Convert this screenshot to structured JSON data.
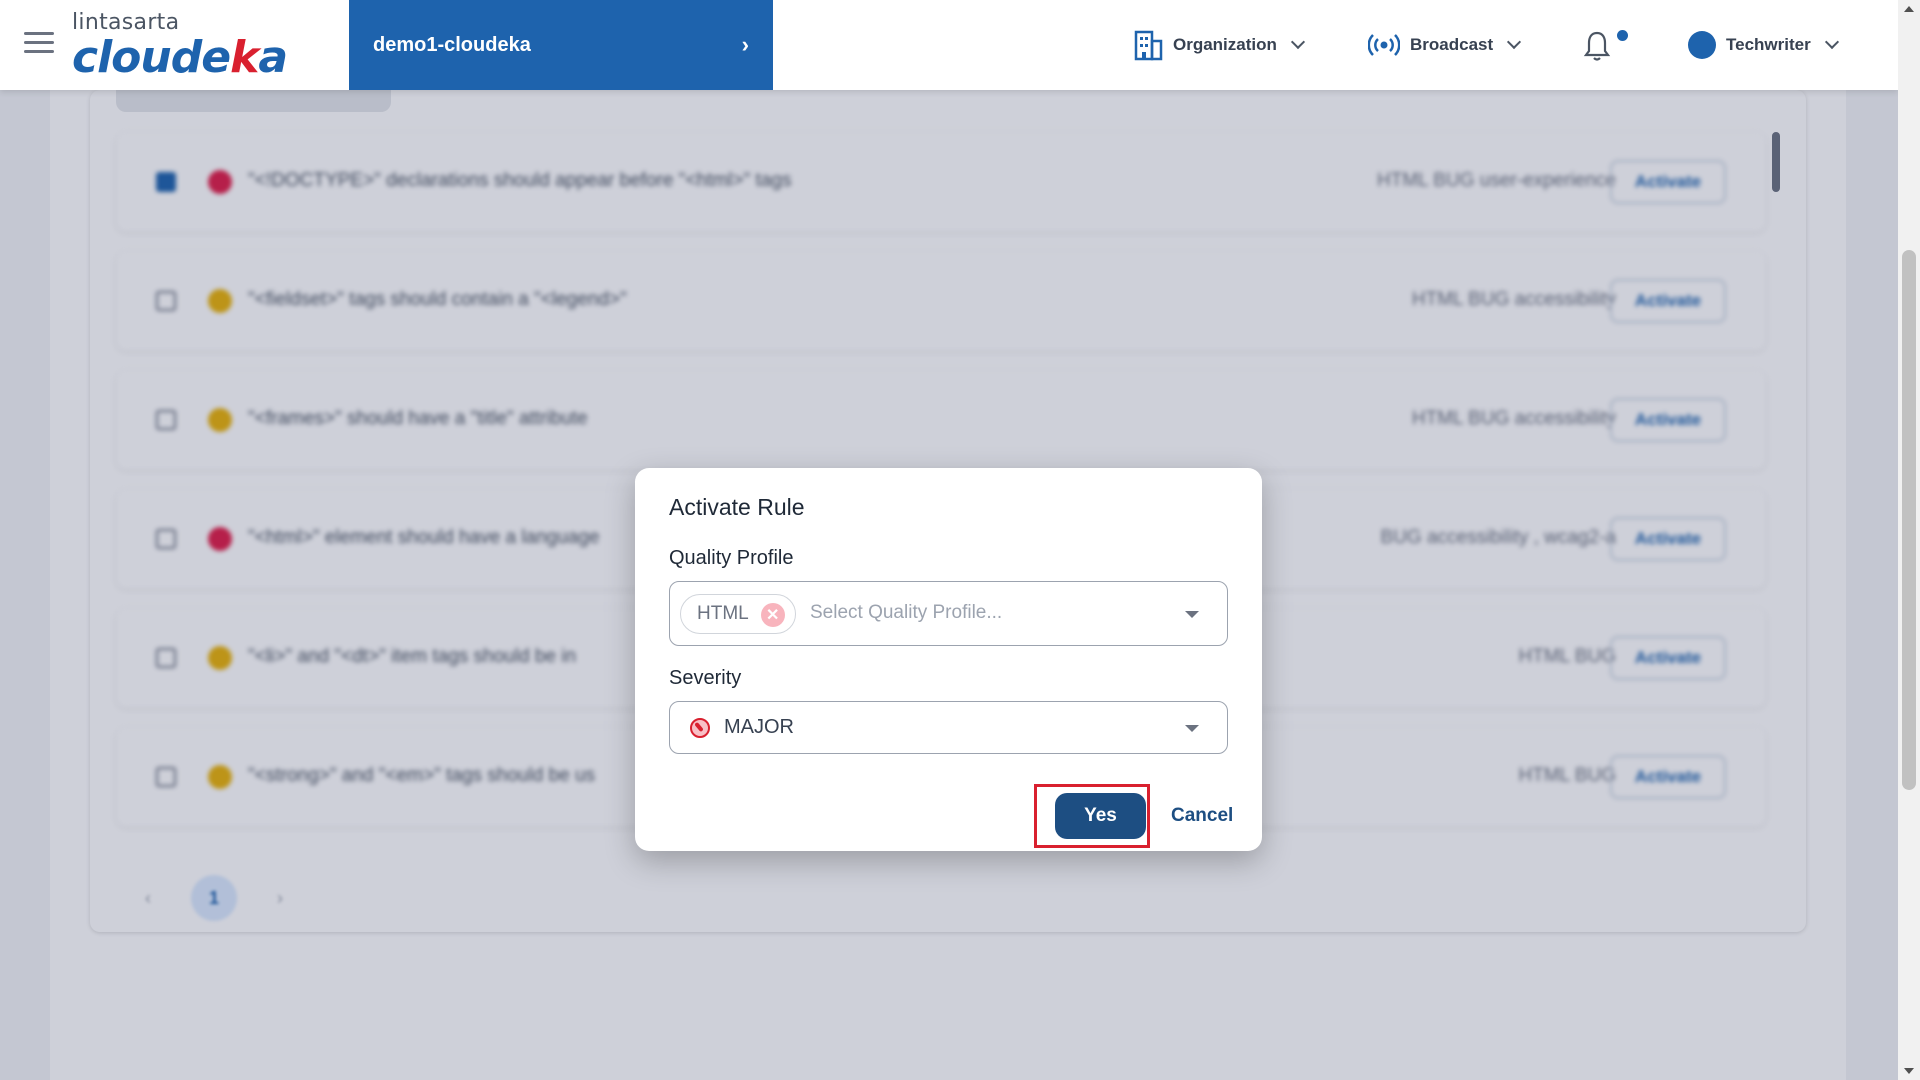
{
  "header": {
    "logo_top": "lintasarta",
    "logo_main_prefix": "cloude",
    "logo_main_accent": "k",
    "logo_main_suffix": "a",
    "project_name": "demo1-cloudeka",
    "nav": {
      "organization": "Organization",
      "broadcast": "Broadcast",
      "user": "Techwriter"
    }
  },
  "rules": [
    {
      "title": "\"<!DOCTYPE>\" declarations should appear before \"<html>\" tags",
      "meta": "HTML   BUG   user-experience",
      "checked": true,
      "severity": "major"
    },
    {
      "title": "\"<fieldset>\" tags should contain a \"<legend>\"",
      "meta": "HTML   BUG   accessibility",
      "checked": false,
      "severity": "minor"
    },
    {
      "title": "\"<frames>\" should have a \"title\" attribute",
      "meta": "HTML   BUG   accessibility",
      "checked": false,
      "severity": "minor"
    },
    {
      "title": "\"<html>\" element should have a language",
      "meta": "BUG   accessibility , wcag2-a",
      "checked": false,
      "severity": "major"
    },
    {
      "title": "\"<li>\" and \"<dt>\" item tags should be in",
      "meta": "HTML   BUG",
      "checked": false,
      "severity": "minor"
    },
    {
      "title": "\"<strong>\" and \"<em>\" tags should be us",
      "meta": "HTML   BUG",
      "checked": false,
      "severity": "minor"
    }
  ],
  "row_action": "Activate",
  "pagination": {
    "prev": "‹",
    "current": "1",
    "next": "›"
  },
  "modal": {
    "title": "Activate Rule",
    "quality_profile_label": "Quality Profile",
    "quality_profile_chip": "HTML",
    "quality_profile_placeholder": "Select Quality Profile...",
    "severity_label": "Severity",
    "severity_value": "MAJOR",
    "yes_label": "Yes",
    "cancel_label": "Cancel"
  },
  "colors": {
    "brand_blue": "#1e63ad",
    "brand_red": "#d9202f",
    "button_blue": "#1d4e82",
    "severity_major": "#e11d48",
    "severity_minor": "#eab308"
  }
}
